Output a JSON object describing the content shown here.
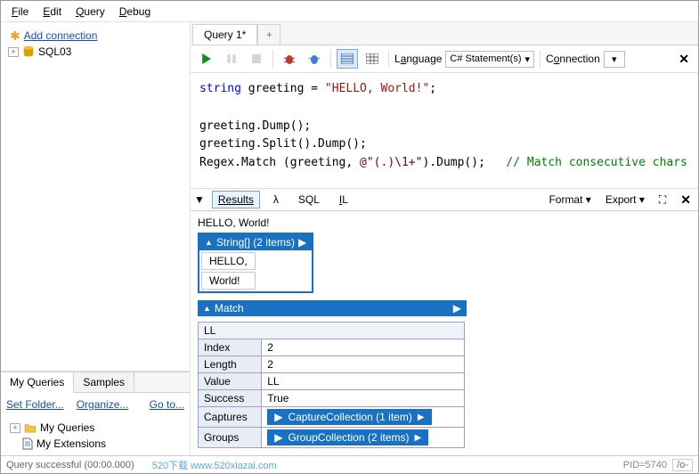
{
  "menubar": {
    "file": "File",
    "edit": "Edit",
    "query": "Query",
    "debug": "Debug"
  },
  "connections": {
    "add": "Add connection",
    "items": [
      "SQL03"
    ]
  },
  "myqueries": {
    "tabs": [
      "My Queries",
      "Samples"
    ],
    "links": {
      "set_folder": "Set Folder...",
      "organize": "Organize...",
      "goto": "Go to..."
    },
    "tree": [
      "My Queries",
      "My Extensions"
    ]
  },
  "doc_tab": "Query 1*",
  "toolbar": {
    "language_label": "Language",
    "language_value": "C# Statement(s)",
    "connection_label": "Connection"
  },
  "code": {
    "l1a": "string",
    "l1b": " greeting = ",
    "l1c": "\"HELLO, World!\"",
    "l1d": ";",
    "l3": "greeting.Dump();",
    "l4": "greeting.Split().Dump();",
    "l5a": "Regex.Match (greeting, ",
    "l5b": "@\"(.)\\1+\"",
    "l5c": ").Dump();   ",
    "l5d": "// Match consecutive chars"
  },
  "results": {
    "tabs": {
      "results": "Results",
      "lambda": "λ",
      "sql": "SQL",
      "il": "IL"
    },
    "format": "Format",
    "export": "Export",
    "line1": "HELLO, World!",
    "string_header": "String[] (2 items)",
    "string_items": [
      "HELLO,",
      "World!"
    ],
    "match_header": "Match",
    "match_val0": "LL",
    "rows": {
      "Index": "2",
      "Length": "2",
      "Value": "LL",
      "Success": "True"
    },
    "captures_label": "Captures",
    "captures_nested": "CaptureCollection (1 item)",
    "groups_label": "Groups",
    "groups_nested": "GroupCollection (2 items)"
  },
  "status": {
    "msg": "Query successful",
    "time": "(00:00.000)",
    "watermark": "520下载 www.520xiazai.com",
    "pid": "PID=5740",
    "mode": "/o-"
  }
}
